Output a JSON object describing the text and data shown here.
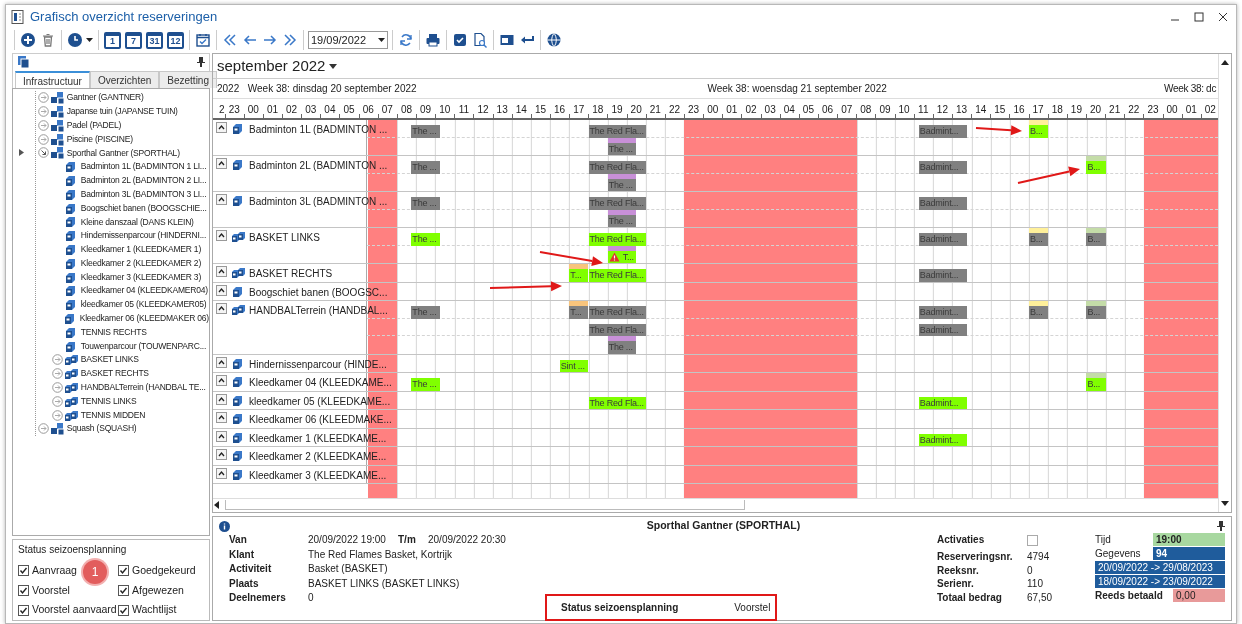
{
  "window": {
    "title": "Grafisch overzicht reserveringen"
  },
  "toolbar": {
    "groups": [
      {
        "items": [
          {
            "kind": "add"
          },
          {
            "kind": "delete"
          }
        ]
      },
      {
        "items": [
          {
            "kind": "clock"
          }
        ]
      },
      {
        "items": [
          {
            "kind": "calendar",
            "label": "1"
          },
          {
            "kind": "calendar",
            "label": "7"
          },
          {
            "kind": "calendar",
            "label": "31"
          },
          {
            "kind": "calendar",
            "label": "12"
          }
        ]
      },
      {
        "items": [
          {
            "kind": "calendar-check"
          }
        ]
      },
      {
        "items": [
          {
            "kind": "first"
          },
          {
            "kind": "prev"
          },
          {
            "kind": "next"
          },
          {
            "kind": "last"
          }
        ]
      },
      {
        "items": [
          {
            "kind": "date",
            "value": "19/09/2022"
          }
        ]
      },
      {
        "items": [
          {
            "kind": "refresh"
          }
        ]
      },
      {
        "items": [
          {
            "kind": "print"
          }
        ]
      },
      {
        "items": [
          {
            "kind": "check"
          },
          {
            "kind": "doc-search"
          }
        ]
      },
      {
        "items": [
          {
            "kind": "window"
          },
          {
            "kind": "undo"
          }
        ]
      },
      {
        "items": [
          {
            "kind": "globe"
          }
        ]
      }
    ]
  },
  "sidebar": {
    "tabs": [
      {
        "label": "Infrastructuur",
        "selected": true
      },
      {
        "label": "Overzichten",
        "selected": false
      },
      {
        "label": "Bezetting",
        "selected": false
      }
    ],
    "tree": [
      {
        "label": "Gantner (GANTNER)",
        "kind": "complex",
        "expanded": false,
        "selected": false
      },
      {
        "label": "Japanse tuin (JAPANSE TUIN)",
        "kind": "complex",
        "expanded": false,
        "selected": false
      },
      {
        "label": "Padel (PADEL)",
        "kind": "complex",
        "expanded": false,
        "selected": false
      },
      {
        "label": "Piscine (PISCINE)",
        "kind": "complex",
        "expanded": false,
        "selected": false
      },
      {
        "label": "Sporthal Gantner (SPORTHAL)",
        "kind": "complex",
        "expanded": true,
        "selected": true,
        "children": [
          {
            "label": "Badminton 1L (BADMINTON 1 LI...",
            "kind": "room",
            "selected": false
          },
          {
            "label": "Badminton 2L (BADMINTON 2 LI...",
            "kind": "room",
            "selected": false
          },
          {
            "label": "Badminton 3L (BADMINTON 3 LI...",
            "kind": "room",
            "selected": false
          },
          {
            "label": "Boogschiet banen (BOOGSCHIE...",
            "kind": "room",
            "selected": false
          },
          {
            "label": "Kleine danszaal (DANS KLEIN)",
            "kind": "room",
            "selected": false
          },
          {
            "label": "Hindernissenparcour (HINDERNI...",
            "kind": "room",
            "selected": false
          },
          {
            "label": "Kleedkamer 1 (KLEEDKAMER 1)",
            "kind": "room",
            "selected": false
          },
          {
            "label": "Kleedkamer 2 (KLEEDKAMER 2)",
            "kind": "room",
            "selected": false
          },
          {
            "label": "Kleedkamer 3 (KLEEDKAMER 3)",
            "kind": "room",
            "selected": false
          },
          {
            "label": "Kleedkamer 04 (KLEEDKAMER04)",
            "kind": "room",
            "selected": false
          },
          {
            "label": "kleedkamer 05 (KLEEDKAMER05)",
            "kind": "room",
            "selected": false
          },
          {
            "label": "Kleedkamer 06 (KLEEDMAKER 06)",
            "kind": "room",
            "selected": false
          },
          {
            "label": "TENNIS RECHTS",
            "kind": "room",
            "selected": false
          },
          {
            "label": "Touwenparcour (TOUWENPARC...",
            "kind": "room",
            "selected": false
          },
          {
            "label": "BASKET LINKS",
            "kind": "group",
            "expanded": false,
            "selected": false
          },
          {
            "label": "BASKET RECHTS",
            "kind": "group",
            "expanded": false,
            "selected": false
          },
          {
            "label": "HANDBALTerrein (HANDBAL TE...",
            "kind": "group",
            "expanded": false,
            "selected": false
          },
          {
            "label": "TENNIS LINKS",
            "kind": "group",
            "expanded": false,
            "selected": false
          },
          {
            "label": "TENNIS MIDDEN",
            "kind": "group",
            "expanded": false,
            "selected": false
          }
        ]
      },
      {
        "label": "Squash (SQUASH)",
        "kind": "complex",
        "expanded": false,
        "selected": false
      }
    ]
  },
  "season_status": {
    "title": "Status seizoensplanning",
    "badge": "1",
    "options": [
      {
        "label": "Aanvraag",
        "checked": true
      },
      {
        "label": "Goedgekeurd",
        "checked": true
      },
      {
        "label": "Voorstel",
        "checked": true
      },
      {
        "label": "Afgewezen",
        "checked": true
      },
      {
        "label": "Voorstel aanvaard",
        "checked": true
      },
      {
        "label": "Wachtlijst",
        "checked": true
      }
    ]
  },
  "planner": {
    "month": "september 2022",
    "days": [
      "2022",
      "Week 38: dinsdag 20 september 2022",
      "Week 38: woensdag 21 september 2022",
      "Week 38: dc"
    ],
    "hours": [
      "2",
      "23",
      "00",
      "01",
      "02",
      "03",
      "04",
      "05",
      "06",
      "07",
      "08",
      "09",
      "10",
      "11",
      "12",
      "13",
      "14",
      "15",
      "16",
      "17",
      "18",
      "19",
      "20",
      "21",
      "22",
      "23",
      "00",
      "01",
      "02",
      "03",
      "04",
      "05",
      "06",
      "07",
      "08",
      "09",
      "10",
      "11",
      "12",
      "13",
      "14",
      "15",
      "16",
      "17",
      "18",
      "19",
      "20",
      "21",
      "22",
      "23",
      "00",
      "01",
      "02"
    ],
    "resources": [
      {
        "label": "Badminton 1L (BADMINTON ...",
        "kind": "room",
        "lanes": [
          {
            "bookings": [
              {
                "label": "The ...",
                "color": "#808080",
                "warning": false
              },
              {
                "label": "The Red Fla...",
                "color": "#808080",
                "warning": false
              },
              {
                "label": "Badmint...",
                "color": "#808080",
                "warning": false
              },
              {
                "label": "B...",
                "color": "#80ff00",
                "status": {
                  "color": "#fff09a"
                },
                "warning": false
              }
            ]
          },
          {
            "bookings": [
              {
                "label": "The ...",
                "color": "#808080",
                "status": {
                  "color": "#c890d8"
                },
                "warning": false
              }
            ]
          }
        ]
      },
      {
        "label": "Badminton 2L (BADMINTON ...",
        "kind": "room",
        "lanes": [
          {
            "bookings": [
              {
                "label": "The ...",
                "color": "#808080",
                "warning": false
              },
              {
                "label": "The Red Fla...",
                "color": "#808080",
                "warning": false
              },
              {
                "label": "Badmint...",
                "color": "#808080",
                "warning": false
              },
              {
                "label": "B...",
                "color": "#80ff00",
                "status": {
                  "color": "#c4dca8"
                },
                "warning": false
              }
            ]
          },
          {
            "bookings": [
              {
                "label": "The ...",
                "color": "#808080",
                "status": {
                  "color": "#c890d8"
                },
                "warning": false
              }
            ]
          }
        ]
      },
      {
        "label": "Badminton 3L (BADMINTON ...",
        "kind": "room",
        "lanes": [
          {
            "bookings": [
              {
                "label": "The ...",
                "color": "#808080",
                "warning": false
              },
              {
                "label": "The Red Fla...",
                "color": "#808080",
                "warning": false
              },
              {
                "label": "Badmint...",
                "color": "#808080",
                "warning": false
              }
            ]
          },
          {
            "bookings": [
              {
                "label": "The ...",
                "color": "#808080",
                "status": {
                  "color": "#c890d8"
                },
                "warning": false
              }
            ]
          }
        ]
      },
      {
        "label": "BASKET LINKS",
        "kind": "group",
        "lanes": [
          {
            "bookings": [
              {
                "label": "The ...",
                "color": "#80ff00",
                "warning": false
              },
              {
                "label": "The Red Fla...",
                "color": "#80ff00",
                "warning": false
              },
              {
                "label": "Badmint...",
                "color": "#808080",
                "warning": false
              },
              {
                "label": "B...",
                "color": "#808080",
                "status": {
                  "color": "#fff09a"
                },
                "warning": false
              },
              {
                "label": "B...",
                "color": "#808080",
                "status": {
                  "color": "#c4dca8"
                },
                "warning": false
              }
            ]
          },
          {
            "bookings": [
              {
                "label": "T...",
                "color": "#80ff00",
                "status": {
                  "color": "#c890d8"
                },
                "warning": true
              }
            ]
          }
        ]
      },
      {
        "label": "BASKET RECHTS",
        "kind": "group",
        "lanes": [
          {
            "bookings": [
              {
                "label": "T...",
                "color": "#80ff00",
                "status": {
                  "color": "#f8c47c"
                },
                "warning": false
              },
              {
                "label": "The Red Fla...",
                "color": "#80ff00",
                "warning": false
              },
              {
                "label": "Badmint...",
                "color": "#808080",
                "warning": false
              }
            ]
          }
        ]
      },
      {
        "label": "Boogschiet banen (BOOGSC...",
        "kind": "room"
      },
      {
        "label": "HANDBALTerrein (HANDBAL...",
        "kind": "group",
        "lanes": [
          {
            "bookings": [
              {
                "label": "The ...",
                "color": "#808080",
                "warning": false
              },
              {
                "label": "T...",
                "color": "#808080",
                "status": {
                  "color": "#f8c47c"
                },
                "warning": false
              },
              {
                "label": "The Red Fla...",
                "color": "#808080",
                "warning": false
              },
              {
                "label": "Badmint...",
                "color": "#808080",
                "warning": false
              },
              {
                "label": "B...",
                "color": "#808080",
                "status": {
                  "color": "#fff09a"
                },
                "warning": false
              },
              {
                "label": "B...",
                "color": "#808080",
                "status": {
                  "color": "#c4dca8"
                },
                "warning": false
              }
            ]
          },
          {
            "bookings": [
              {
                "label": "The Red Fla...",
                "color": "#808080",
                "warning": false
              },
              {
                "label": "Badmint...",
                "color": "#808080",
                "warning": false
              }
            ]
          },
          {
            "bookings": [
              {
                "label": "The ...",
                "color": "#808080",
                "status": {
                  "color": "#c890d8"
                },
                "warning": false
              }
            ]
          }
        ]
      },
      {
        "label": "Hindernissenparcour (HINDE...",
        "kind": "room",
        "lanes": [
          {
            "bookings": [
              {
                "label": "Sint ...",
                "color": "#80ff00",
                "warning": false
              }
            ]
          }
        ]
      },
      {
        "label": "Kleedkamer 04 (KLEEDKAME...",
        "kind": "room",
        "lanes": [
          {
            "bookings": [
              {
                "label": "The ...",
                "color": "#80ff00",
                "warning": false
              },
              {
                "label": "B...",
                "color": "#80ff00",
                "status": {
                  "color": "#c4dca8"
                },
                "warning": false
              }
            ]
          }
        ]
      },
      {
        "label": "kleedkamer 05 (KLEEDKAME...",
        "kind": "room",
        "lanes": [
          {
            "bookings": [
              {
                "label": "The Red Fla...",
                "color": "#80ff00",
                "warning": false
              },
              {
                "label": "Badmint...",
                "color": "#80ff00",
                "warning": false
              }
            ]
          }
        ]
      },
      {
        "label": "Kleedkamer 06 (KLEEDMAKE...",
        "kind": "room"
      },
      {
        "label": "Kleedkamer 1 (KLEEDKAME...",
        "kind": "room",
        "lanes": [
          {
            "bookings": [
              {
                "label": "Badmint...",
                "color": "#80ff00",
                "warning": false
              }
            ]
          }
        ]
      },
      {
        "label": "Kleedkamer 2 (KLEEDKAME...",
        "kind": "room"
      },
      {
        "label": "Kleedkamer 3 (KLEEDKAME...",
        "kind": "room"
      }
    ]
  },
  "details": {
    "title": "Sporthal Gantner (SPORTHAL)",
    "fields": [
      {
        "label": "Van",
        "value": "20/09/2022 19:00"
      },
      {
        "label": "T/m",
        "value": "20/09/2022 20:30"
      },
      {
        "label": "Klant",
        "value": "The Red Flames Basket, Kortrijk"
      },
      {
        "label": "Activiteit",
        "value": "Basket (BASKET)"
      },
      {
        "label": "Plaats",
        "value": "BASKET LINKS (BASKET LINKS)"
      },
      {
        "label": "Deelnemers",
        "value": "0"
      }
    ],
    "season_status": {
      "label": "Status seizoensplanning",
      "value": "Voorstel"
    },
    "summary": [
      {
        "label": "Activaties",
        "kind": "checkbox",
        "checked": false
      },
      {
        "label": "Reserveringsnr.",
        "kind": "text",
        "value": "4794"
      },
      {
        "label": "Reeksnr.",
        "kind": "text",
        "value": "0"
      },
      {
        "label": "Serienr.",
        "kind": "text",
        "value": "110"
      },
      {
        "label": "Totaal bedrag",
        "kind": "text",
        "value": "67,50"
      }
    ],
    "indicators": [
      {
        "label": "Tijd",
        "kind": "time",
        "value": "19:00",
        "color": "#a8d8a0"
      },
      {
        "label": "Gegevens",
        "kind": "count",
        "value": "94",
        "color": "#1f5c9c"
      },
      {
        "kind": "range",
        "value": "20/09/2022 -> 29/08/2023",
        "color": "#1f5c9c"
      },
      {
        "kind": "range",
        "value": "18/09/2022 -> 23/09/2022",
        "color": "#1f5c9c"
      },
      {
        "label": "Reeds betaald",
        "kind": "payment",
        "value": "0,00",
        "color": "#e89a9a"
      }
    ]
  }
}
